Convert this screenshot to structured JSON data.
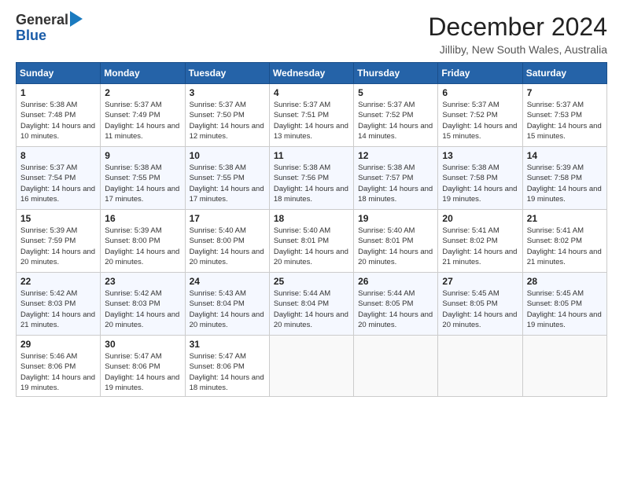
{
  "logo": {
    "general": "General",
    "blue": "Blue"
  },
  "title": "December 2024",
  "subtitle": "Jilliby, New South Wales, Australia",
  "days_header": [
    "Sunday",
    "Monday",
    "Tuesday",
    "Wednesday",
    "Thursday",
    "Friday",
    "Saturday"
  ],
  "weeks": [
    [
      {
        "day": "1",
        "sunrise": "5:38 AM",
        "sunset": "7:48 PM",
        "daylight": "14 hours and 10 minutes."
      },
      {
        "day": "2",
        "sunrise": "5:37 AM",
        "sunset": "7:49 PM",
        "daylight": "14 hours and 11 minutes."
      },
      {
        "day": "3",
        "sunrise": "5:37 AM",
        "sunset": "7:50 PM",
        "daylight": "14 hours and 12 minutes."
      },
      {
        "day": "4",
        "sunrise": "5:37 AM",
        "sunset": "7:51 PM",
        "daylight": "14 hours and 13 minutes."
      },
      {
        "day": "5",
        "sunrise": "5:37 AM",
        "sunset": "7:52 PM",
        "daylight": "14 hours and 14 minutes."
      },
      {
        "day": "6",
        "sunrise": "5:37 AM",
        "sunset": "7:52 PM",
        "daylight": "14 hours and 15 minutes."
      },
      {
        "day": "7",
        "sunrise": "5:37 AM",
        "sunset": "7:53 PM",
        "daylight": "14 hours and 15 minutes."
      }
    ],
    [
      {
        "day": "8",
        "sunrise": "5:37 AM",
        "sunset": "7:54 PM",
        "daylight": "14 hours and 16 minutes."
      },
      {
        "day": "9",
        "sunrise": "5:38 AM",
        "sunset": "7:55 PM",
        "daylight": "14 hours and 17 minutes."
      },
      {
        "day": "10",
        "sunrise": "5:38 AM",
        "sunset": "7:55 PM",
        "daylight": "14 hours and 17 minutes."
      },
      {
        "day": "11",
        "sunrise": "5:38 AM",
        "sunset": "7:56 PM",
        "daylight": "14 hours and 18 minutes."
      },
      {
        "day": "12",
        "sunrise": "5:38 AM",
        "sunset": "7:57 PM",
        "daylight": "14 hours and 18 minutes."
      },
      {
        "day": "13",
        "sunrise": "5:38 AM",
        "sunset": "7:58 PM",
        "daylight": "14 hours and 19 minutes."
      },
      {
        "day": "14",
        "sunrise": "5:39 AM",
        "sunset": "7:58 PM",
        "daylight": "14 hours and 19 minutes."
      }
    ],
    [
      {
        "day": "15",
        "sunrise": "5:39 AM",
        "sunset": "7:59 PM",
        "daylight": "14 hours and 20 minutes."
      },
      {
        "day": "16",
        "sunrise": "5:39 AM",
        "sunset": "8:00 PM",
        "daylight": "14 hours and 20 minutes."
      },
      {
        "day": "17",
        "sunrise": "5:40 AM",
        "sunset": "8:00 PM",
        "daylight": "14 hours and 20 minutes."
      },
      {
        "day": "18",
        "sunrise": "5:40 AM",
        "sunset": "8:01 PM",
        "daylight": "14 hours and 20 minutes."
      },
      {
        "day": "19",
        "sunrise": "5:40 AM",
        "sunset": "8:01 PM",
        "daylight": "14 hours and 20 minutes."
      },
      {
        "day": "20",
        "sunrise": "5:41 AM",
        "sunset": "8:02 PM",
        "daylight": "14 hours and 21 minutes."
      },
      {
        "day": "21",
        "sunrise": "5:41 AM",
        "sunset": "8:02 PM",
        "daylight": "14 hours and 21 minutes."
      }
    ],
    [
      {
        "day": "22",
        "sunrise": "5:42 AM",
        "sunset": "8:03 PM",
        "daylight": "14 hours and 21 minutes."
      },
      {
        "day": "23",
        "sunrise": "5:42 AM",
        "sunset": "8:03 PM",
        "daylight": "14 hours and 20 minutes."
      },
      {
        "day": "24",
        "sunrise": "5:43 AM",
        "sunset": "8:04 PM",
        "daylight": "14 hours and 20 minutes."
      },
      {
        "day": "25",
        "sunrise": "5:44 AM",
        "sunset": "8:04 PM",
        "daylight": "14 hours and 20 minutes."
      },
      {
        "day": "26",
        "sunrise": "5:44 AM",
        "sunset": "8:05 PM",
        "daylight": "14 hours and 20 minutes."
      },
      {
        "day": "27",
        "sunrise": "5:45 AM",
        "sunset": "8:05 PM",
        "daylight": "14 hours and 20 minutes."
      },
      {
        "day": "28",
        "sunrise": "5:45 AM",
        "sunset": "8:05 PM",
        "daylight": "14 hours and 19 minutes."
      }
    ],
    [
      {
        "day": "29",
        "sunrise": "5:46 AM",
        "sunset": "8:06 PM",
        "daylight": "14 hours and 19 minutes."
      },
      {
        "day": "30",
        "sunrise": "5:47 AM",
        "sunset": "8:06 PM",
        "daylight": "14 hours and 19 minutes."
      },
      {
        "day": "31",
        "sunrise": "5:47 AM",
        "sunset": "8:06 PM",
        "daylight": "14 hours and 18 minutes."
      },
      null,
      null,
      null,
      null
    ]
  ]
}
